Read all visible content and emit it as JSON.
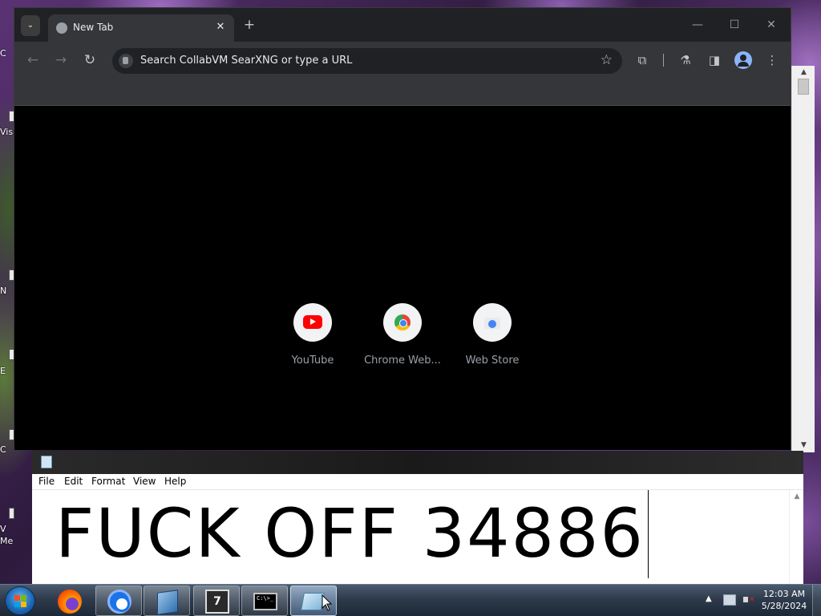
{
  "desktop": {
    "icon_labels": [
      "C",
      "Vis",
      "N",
      "E",
      "C",
      "V",
      "Me"
    ]
  },
  "browser": {
    "tab_search_glyph": "⌄",
    "tab": {
      "title": "New Tab",
      "close_glyph": "✕"
    },
    "new_tab_glyph": "+",
    "window_controls": {
      "minimize": "—",
      "maximize": "☐",
      "close": "✕"
    },
    "nav": {
      "back": "←",
      "forward": "→",
      "reload": "↻"
    },
    "omnibox": {
      "placeholder": "Search CollabVM SearXNG or type a URL",
      "star_glyph": "☆"
    },
    "toolbar_icons": {
      "extensions": "⧉",
      "labs": "⚗",
      "side_panel": "◨",
      "menu": "⋮"
    },
    "shortcuts": [
      {
        "label": "YouTube",
        "icon": "youtube-icon"
      },
      {
        "label": "Chrome Web...",
        "icon": "chrome-web-store-icon"
      },
      {
        "label": "Web Store",
        "icon": "web-store-icon"
      }
    ],
    "scroll": {
      "up": "▲",
      "down": "▼"
    }
  },
  "notepad": {
    "menu": [
      "File",
      "Edit",
      "Format",
      "View",
      "Help"
    ],
    "content": "FUCK OFF 34886",
    "scroll_up": "▲"
  },
  "taskbar": {
    "apps": [
      {
        "name": "Firefox",
        "icon": "firefox-icon",
        "state": "pinned"
      },
      {
        "name": "Chrome",
        "icon": "chrome-icon",
        "state": "running"
      },
      {
        "name": "VirtualBox",
        "icon": "virtualbox-icon",
        "state": "running"
      },
      {
        "name": "Windows 7 64",
        "icon": "win7-64-icon",
        "state": "running",
        "text": "7"
      },
      {
        "name": "Command Prompt",
        "icon": "cmd-icon",
        "state": "running",
        "text": "C:\\>_"
      },
      {
        "name": "Notepad",
        "icon": "notepad-icon",
        "state": "active"
      }
    ],
    "tray": {
      "chevron": "▲"
    },
    "clock": {
      "time": "12:03 AM",
      "date": "5/28/2024"
    }
  },
  "colors": {
    "chrome_frame": "#202124",
    "chrome_toolbar": "#35363a",
    "ntp_background": "#000000",
    "youtube_red": "#ff0000",
    "taskbar": "#2e3b4c"
  }
}
